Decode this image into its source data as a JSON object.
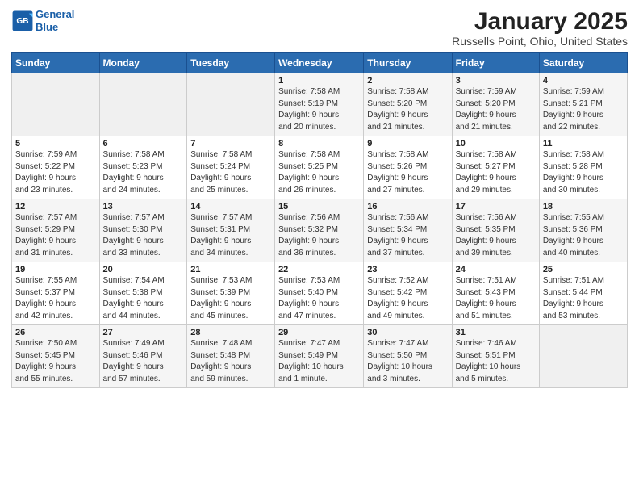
{
  "logo": {
    "line1": "General",
    "line2": "Blue"
  },
  "title": "January 2025",
  "subtitle": "Russells Point, Ohio, United States",
  "weekdays": [
    "Sunday",
    "Monday",
    "Tuesday",
    "Wednesday",
    "Thursday",
    "Friday",
    "Saturday"
  ],
  "weeks": [
    [
      {
        "num": "",
        "detail": ""
      },
      {
        "num": "",
        "detail": ""
      },
      {
        "num": "",
        "detail": ""
      },
      {
        "num": "1",
        "detail": "Sunrise: 7:58 AM\nSunset: 5:19 PM\nDaylight: 9 hours\nand 20 minutes."
      },
      {
        "num": "2",
        "detail": "Sunrise: 7:58 AM\nSunset: 5:20 PM\nDaylight: 9 hours\nand 21 minutes."
      },
      {
        "num": "3",
        "detail": "Sunrise: 7:59 AM\nSunset: 5:20 PM\nDaylight: 9 hours\nand 21 minutes."
      },
      {
        "num": "4",
        "detail": "Sunrise: 7:59 AM\nSunset: 5:21 PM\nDaylight: 9 hours\nand 22 minutes."
      }
    ],
    [
      {
        "num": "5",
        "detail": "Sunrise: 7:59 AM\nSunset: 5:22 PM\nDaylight: 9 hours\nand 23 minutes."
      },
      {
        "num": "6",
        "detail": "Sunrise: 7:58 AM\nSunset: 5:23 PM\nDaylight: 9 hours\nand 24 minutes."
      },
      {
        "num": "7",
        "detail": "Sunrise: 7:58 AM\nSunset: 5:24 PM\nDaylight: 9 hours\nand 25 minutes."
      },
      {
        "num": "8",
        "detail": "Sunrise: 7:58 AM\nSunset: 5:25 PM\nDaylight: 9 hours\nand 26 minutes."
      },
      {
        "num": "9",
        "detail": "Sunrise: 7:58 AM\nSunset: 5:26 PM\nDaylight: 9 hours\nand 27 minutes."
      },
      {
        "num": "10",
        "detail": "Sunrise: 7:58 AM\nSunset: 5:27 PM\nDaylight: 9 hours\nand 29 minutes."
      },
      {
        "num": "11",
        "detail": "Sunrise: 7:58 AM\nSunset: 5:28 PM\nDaylight: 9 hours\nand 30 minutes."
      }
    ],
    [
      {
        "num": "12",
        "detail": "Sunrise: 7:57 AM\nSunset: 5:29 PM\nDaylight: 9 hours\nand 31 minutes."
      },
      {
        "num": "13",
        "detail": "Sunrise: 7:57 AM\nSunset: 5:30 PM\nDaylight: 9 hours\nand 33 minutes."
      },
      {
        "num": "14",
        "detail": "Sunrise: 7:57 AM\nSunset: 5:31 PM\nDaylight: 9 hours\nand 34 minutes."
      },
      {
        "num": "15",
        "detail": "Sunrise: 7:56 AM\nSunset: 5:32 PM\nDaylight: 9 hours\nand 36 minutes."
      },
      {
        "num": "16",
        "detail": "Sunrise: 7:56 AM\nSunset: 5:34 PM\nDaylight: 9 hours\nand 37 minutes."
      },
      {
        "num": "17",
        "detail": "Sunrise: 7:56 AM\nSunset: 5:35 PM\nDaylight: 9 hours\nand 39 minutes."
      },
      {
        "num": "18",
        "detail": "Sunrise: 7:55 AM\nSunset: 5:36 PM\nDaylight: 9 hours\nand 40 minutes."
      }
    ],
    [
      {
        "num": "19",
        "detail": "Sunrise: 7:55 AM\nSunset: 5:37 PM\nDaylight: 9 hours\nand 42 minutes."
      },
      {
        "num": "20",
        "detail": "Sunrise: 7:54 AM\nSunset: 5:38 PM\nDaylight: 9 hours\nand 44 minutes."
      },
      {
        "num": "21",
        "detail": "Sunrise: 7:53 AM\nSunset: 5:39 PM\nDaylight: 9 hours\nand 45 minutes."
      },
      {
        "num": "22",
        "detail": "Sunrise: 7:53 AM\nSunset: 5:40 PM\nDaylight: 9 hours\nand 47 minutes."
      },
      {
        "num": "23",
        "detail": "Sunrise: 7:52 AM\nSunset: 5:42 PM\nDaylight: 9 hours\nand 49 minutes."
      },
      {
        "num": "24",
        "detail": "Sunrise: 7:51 AM\nSunset: 5:43 PM\nDaylight: 9 hours\nand 51 minutes."
      },
      {
        "num": "25",
        "detail": "Sunrise: 7:51 AM\nSunset: 5:44 PM\nDaylight: 9 hours\nand 53 minutes."
      }
    ],
    [
      {
        "num": "26",
        "detail": "Sunrise: 7:50 AM\nSunset: 5:45 PM\nDaylight: 9 hours\nand 55 minutes."
      },
      {
        "num": "27",
        "detail": "Sunrise: 7:49 AM\nSunset: 5:46 PM\nDaylight: 9 hours\nand 57 minutes."
      },
      {
        "num": "28",
        "detail": "Sunrise: 7:48 AM\nSunset: 5:48 PM\nDaylight: 9 hours\nand 59 minutes."
      },
      {
        "num": "29",
        "detail": "Sunrise: 7:47 AM\nSunset: 5:49 PM\nDaylight: 10 hours\nand 1 minute."
      },
      {
        "num": "30",
        "detail": "Sunrise: 7:47 AM\nSunset: 5:50 PM\nDaylight: 10 hours\nand 3 minutes."
      },
      {
        "num": "31",
        "detail": "Sunrise: 7:46 AM\nSunset: 5:51 PM\nDaylight: 10 hours\nand 5 minutes."
      },
      {
        "num": "",
        "detail": ""
      }
    ]
  ]
}
